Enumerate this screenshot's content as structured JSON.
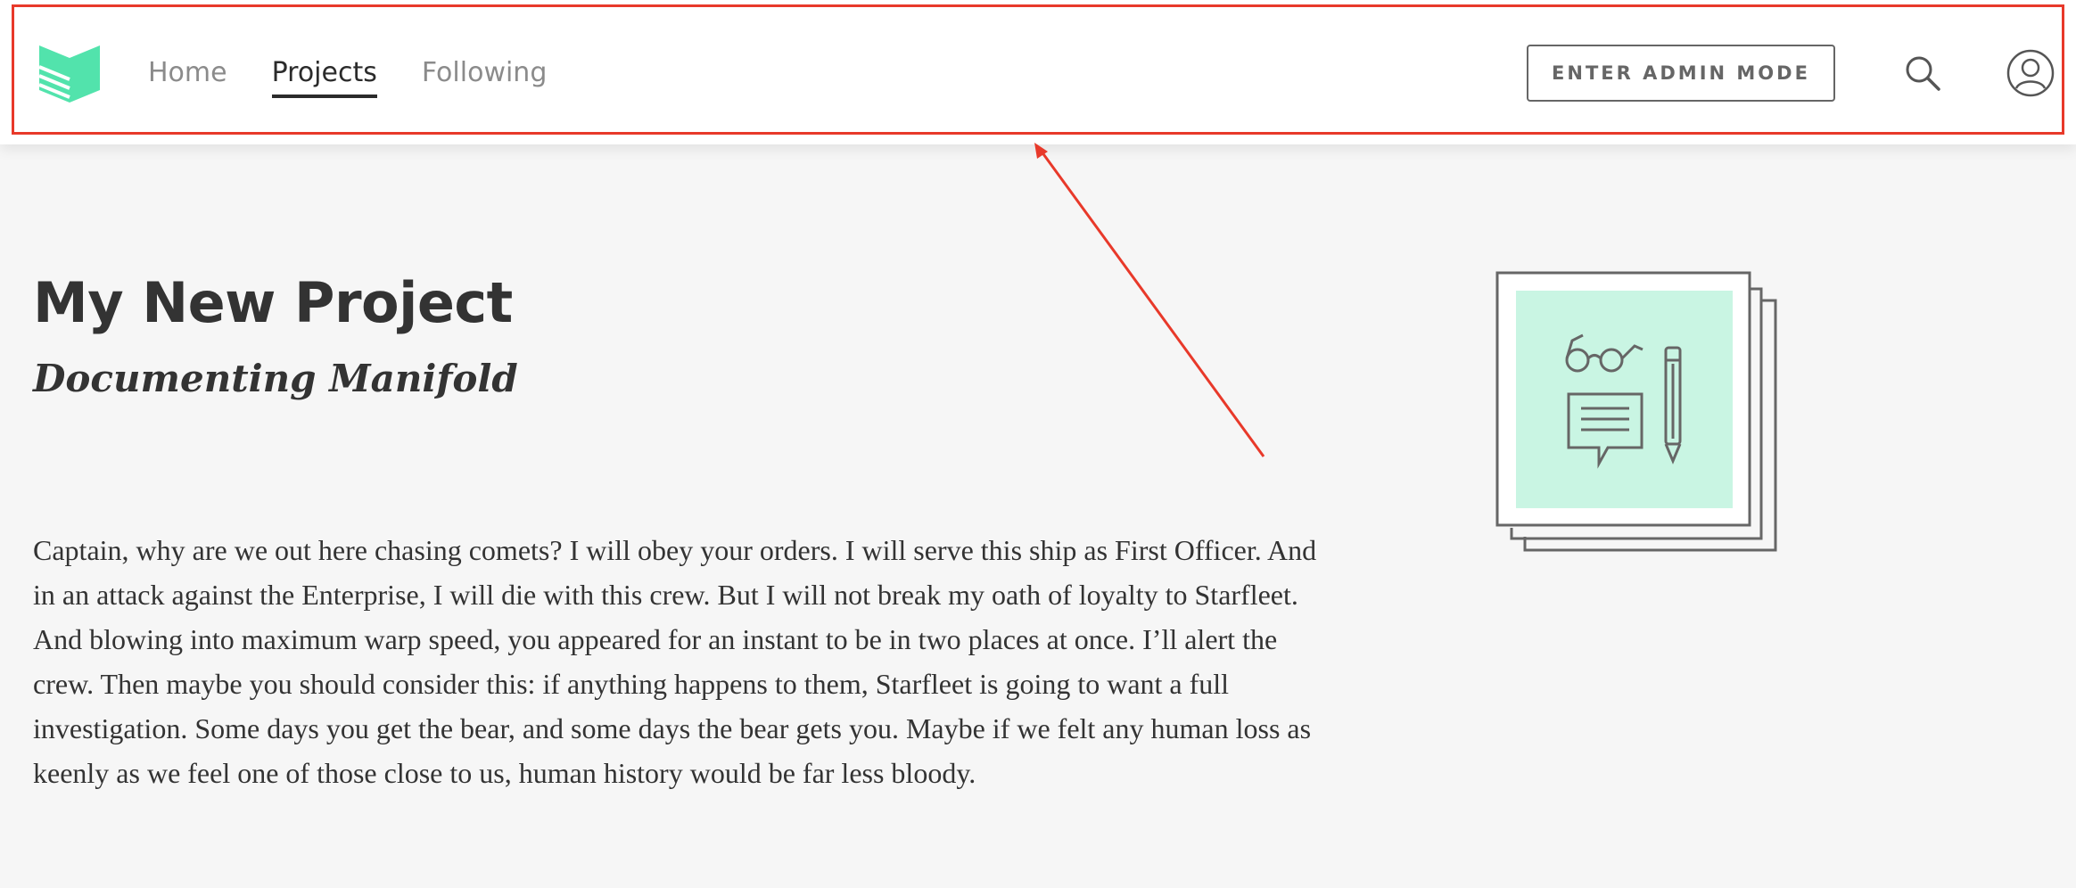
{
  "header": {
    "nav": [
      {
        "label": "Home"
      },
      {
        "label": "Projects",
        "active": true
      },
      {
        "label": "Following"
      }
    ],
    "admin_button_label": "ENTER ADMIN MODE",
    "icons": {
      "logo": "manifold-logo-icon",
      "search": "search-icon",
      "user": "user-avatar-icon"
    }
  },
  "project": {
    "title": "My New Project",
    "subtitle": "Documenting Manifold",
    "description": "Captain, why are we out here chasing comets? I will obey your orders. I will serve this ship as First Officer. And in an attack against the Enterprise, I will die with this crew. But I will not break my oath of loyalty to Starfleet. And blowing into maximum warp speed, you appeared for an instant to be in two places at once. I’ll alert the crew. Then maybe you should consider this: if anything happens to them, Starfleet is going to want a full investigation. Some days you get the bear, and some days the bear gets you. Maybe if we felt any human loss as keenly as we feel one of those close to us, human history would be far less bloody."
  },
  "colors": {
    "brand_green": "#52e3ac",
    "cover_mint": "#c9f5e3",
    "annotation_red": "#e8392a",
    "page_background": "#f6f6f6"
  }
}
